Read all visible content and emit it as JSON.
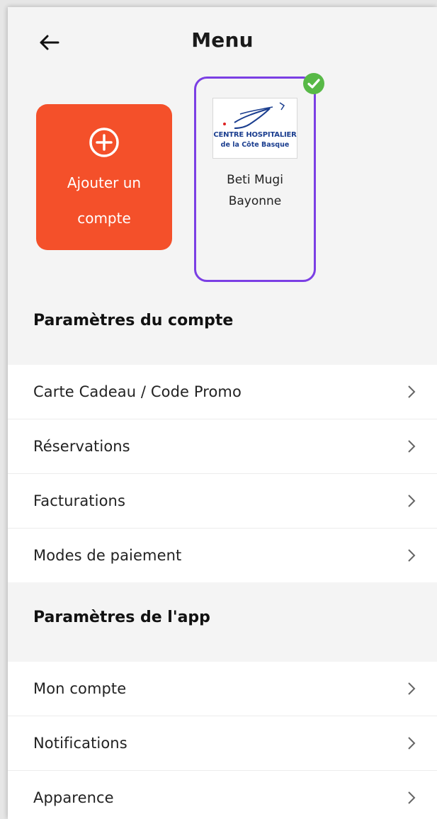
{
  "header": {
    "title": "Menu",
    "back_icon": "arrow-left-icon"
  },
  "accounts": {
    "add_label": "Ajouter un\ncompte",
    "add_icon": "plus-circle-icon",
    "selected_account": {
      "name": "Beti Mugi\nBayonne",
      "logo_line1": "CENTRE HOSPITALIER",
      "logo_line2": "de la Côte Basque",
      "check_icon": "check-circle-icon",
      "border_color": "#7b3fe4"
    },
    "add_color": "#f4502a"
  },
  "account_settings": {
    "title": "Paramètres du compte",
    "items": [
      {
        "label": "Carte Cadeau / Code Promo"
      },
      {
        "label": "Réservations"
      },
      {
        "label": "Facturations"
      },
      {
        "label": "Modes de paiement"
      }
    ]
  },
  "app_settings": {
    "title": "Paramètres de l'app",
    "items": [
      {
        "label": "Mon compte"
      },
      {
        "label": "Notifications"
      },
      {
        "label": "Apparence"
      }
    ]
  }
}
